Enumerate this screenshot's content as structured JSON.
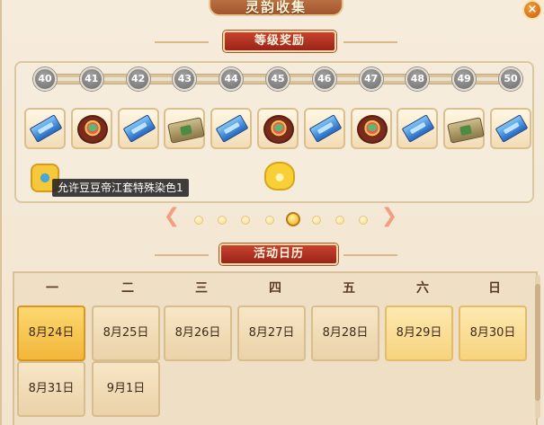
{
  "window": {
    "title": "灵韵收集",
    "close_glyph": "×"
  },
  "level_rewards": {
    "heading": "等级奖励",
    "levels": [
      "40",
      "41",
      "42",
      "43",
      "44",
      "45",
      "46",
      "47",
      "48",
      "49",
      "50"
    ],
    "items": [
      "ticket",
      "basket",
      "ticket",
      "scroll",
      "ticket",
      "basket",
      "ticket",
      "basket",
      "ticket",
      "scroll",
      "ticket"
    ],
    "tooltip": "允许豆豆帝江套特殊染色1"
  },
  "pager": {
    "page_count": 8,
    "current_page": 5,
    "prev_glyph": "❮",
    "next_glyph": "❯"
  },
  "calendar": {
    "heading": "活动日历",
    "weekdays": [
      "一",
      "二",
      "三",
      "四",
      "五",
      "六",
      "日"
    ],
    "days": [
      {
        "label": "8月24日",
        "state": "today"
      },
      {
        "label": "8月25日",
        "state": "normal"
      },
      {
        "label": "8月26日",
        "state": "normal"
      },
      {
        "label": "8月27日",
        "state": "normal"
      },
      {
        "label": "8月28日",
        "state": "normal"
      },
      {
        "label": "8月29日",
        "state": "weekend"
      },
      {
        "label": "8月30日",
        "state": "weekend"
      },
      {
        "label": "8月31日",
        "state": "normal"
      },
      {
        "label": "9月1日",
        "state": "normal"
      }
    ]
  },
  "colors": {
    "banner_red": "#b8321f",
    "today_gold": "#f2b63a",
    "node_gray": "#8a8a8a"
  }
}
